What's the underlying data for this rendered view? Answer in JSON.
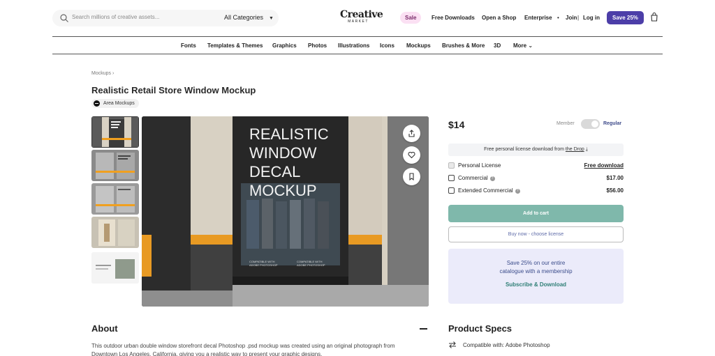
{
  "header": {
    "search_placeholder": "Search millions of creative assets...",
    "category_select": "All Categories",
    "logo_line1": "Creative",
    "logo_line2": "MARKET",
    "sale": "Sale",
    "links": [
      "Free Downloads",
      "Open a Shop",
      "Enterprise",
      "Join",
      "Log in"
    ],
    "save_button": "Save 25%"
  },
  "category_nav": [
    "Fonts",
    "Templates & Themes",
    "Graphics",
    "Photos",
    "Illustrations",
    "Icons",
    "Mockups",
    "Brushes & More",
    "3D",
    "More"
  ],
  "breadcrumb": "Mockups",
  "product": {
    "title": "Realistic Retail Store Window Mockup",
    "shop": "Area Mockups",
    "image_text": [
      "REALISTIC",
      "WINDOW",
      "DECAL",
      "MOCKUP"
    ],
    "image_small_text": [
      "COMPATIBLE WITH",
      "ADOBE PHOTOSHOP"
    ]
  },
  "pricing": {
    "price": "$14",
    "member_label": "Member",
    "regular_label": "Regular",
    "free_bar_prefix": "Free personal license download from",
    "free_bar_link": "the Drop",
    "licenses": [
      {
        "name": "Personal License",
        "value": "Free download"
      },
      {
        "name": "Commercial",
        "value": "$17.00"
      },
      {
        "name": "Extended Commercial",
        "value": "$56.00"
      }
    ],
    "add_to_cart": "Add to cart",
    "buy_now": "Buy now - choose license",
    "promo_line1": "Save 25% on our entire",
    "promo_line2": "catalogue with a membership",
    "promo_cta": "Subscribe & Download"
  },
  "about": {
    "heading": "About",
    "text": "This outdoor urban double window storefront decal Photoshop .psd mockup was created using an original photograph from Downtown Los Angeles, California, giving you a realistic way to present your graphic designs."
  },
  "specs": {
    "heading": "Product Specs",
    "compat": "Compatible with: Adobe Photoshop"
  },
  "colors": {
    "accent_purple": "#4c3ea8",
    "cart_green": "#7fb8ab",
    "promo_bg": "#ebebfa"
  }
}
